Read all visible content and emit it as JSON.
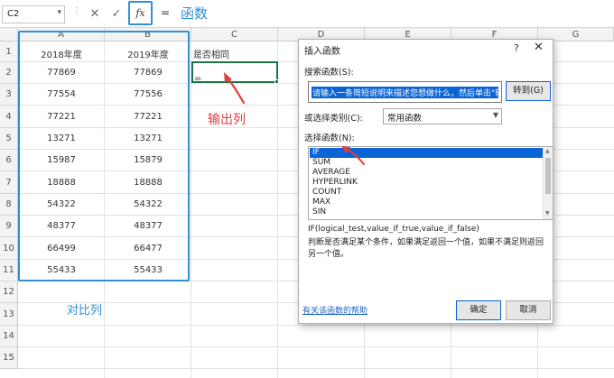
{
  "formula_bar": {
    "name_box": "C2",
    "cancel_symbol": "✕",
    "enter_symbol": "✓",
    "fx_label": "fx",
    "formula_text": "=",
    "annotation": "函数"
  },
  "sheet": {
    "columns": [
      "A",
      "B",
      "C",
      "D",
      "E",
      "F",
      "G"
    ],
    "rows": [
      "1",
      "2",
      "3",
      "4",
      "5",
      "6",
      "7",
      "8",
      "9",
      "10",
      "11",
      "12",
      "13",
      "14",
      "15"
    ],
    "headers": {
      "a1": "2018年度",
      "b1": "2019年度",
      "c1": "是否相同"
    },
    "c2_value": "=",
    "table": [
      [
        "77869",
        "77869"
      ],
      [
        "77554",
        "77556"
      ],
      [
        "77221",
        "77221"
      ],
      [
        "13271",
        "13271"
      ],
      [
        "15987",
        "15879"
      ],
      [
        "18888",
        "18888"
      ],
      [
        "54322",
        "54322"
      ],
      [
        "48377",
        "48377"
      ],
      [
        "66499",
        "66477"
      ],
      [
        "55433",
        "55433"
      ]
    ],
    "annotation_output": "输出列",
    "annotation_compare": "对比列"
  },
  "dialog": {
    "title": "插入函数",
    "help": "?",
    "close": "✕",
    "search_label": "搜索函数(S):",
    "search_value": "请输入一条简短说明来描述您想做什么，然后单击\"转到\"",
    "go_button": "转到(G)",
    "category_label": "或选择类别(C):",
    "category_value": "常用函数",
    "list_label": "选择函数(N):",
    "functions": [
      "IF",
      "SUM",
      "AVERAGE",
      "HYPERLINK",
      "COUNT",
      "MAX",
      "SIN"
    ],
    "selected_function": "IF",
    "syntax": "IF(logical_test,value_if_true,value_if_false)",
    "description": "判断是否满足某个条件，如果满足返回一个值，如果不满足则返回另一个值。",
    "help_link": "有关该函数的帮助",
    "ok_button": "确定",
    "cancel_button": "取消"
  },
  "colors": {
    "accent_blue": "#2f8fd8",
    "annotation_red": "#e23d3d",
    "selection_green": "#217346",
    "list_highlight": "#0a64d6"
  }
}
